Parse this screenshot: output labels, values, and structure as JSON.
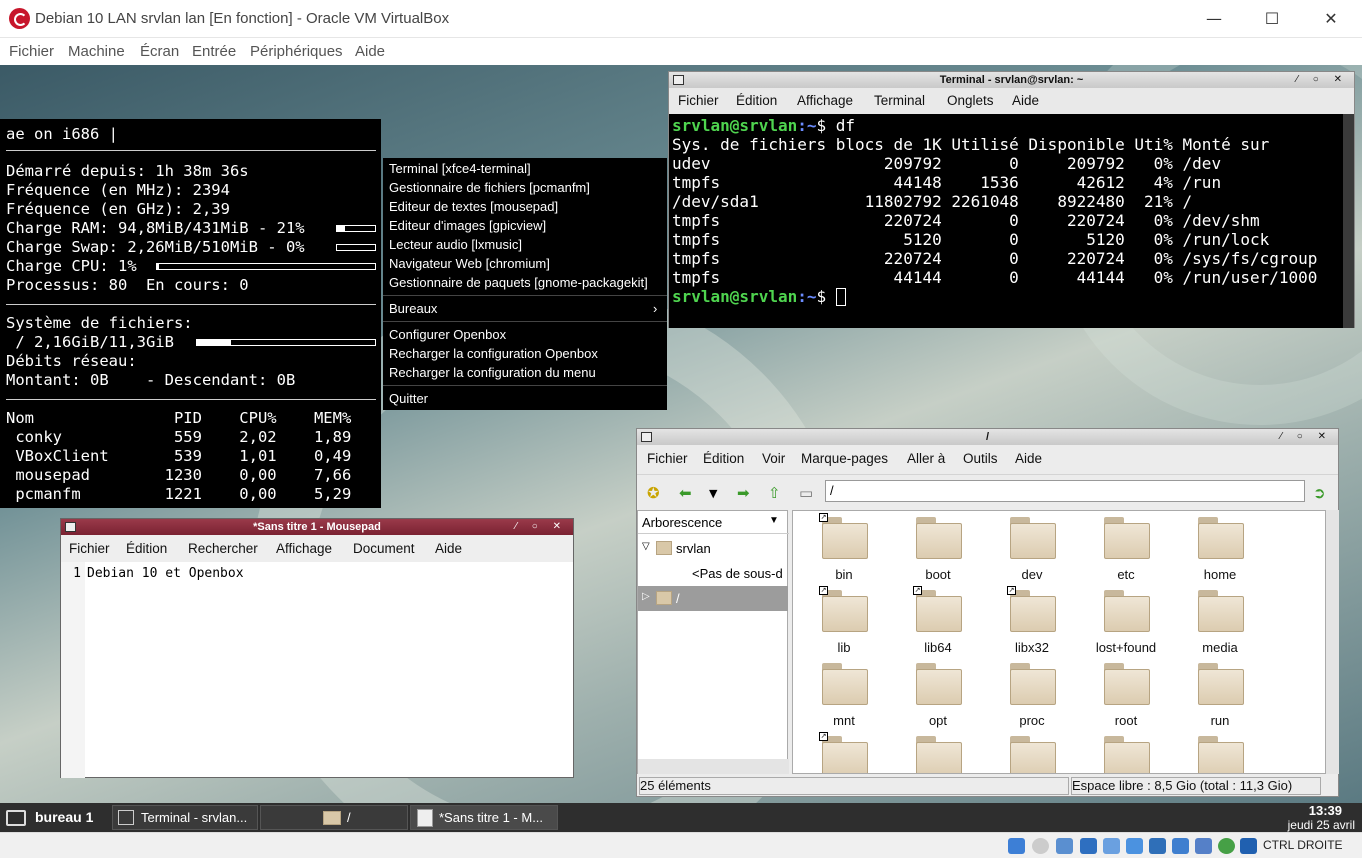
{
  "vbox": {
    "title": "Debian 10 LAN srvlan lan [En fonction] - Oracle VM VirtualBox",
    "menu": [
      "Fichier",
      "Machine",
      "Écran",
      "Entrée",
      "Périphériques",
      "Aide"
    ],
    "min": "—",
    "max": "☐",
    "close": "✕",
    "host_key": "CTRL DROITE"
  },
  "conky": {
    "header": "ae on i686 |",
    "lines": [
      "Démarré depuis: 1h 38m 36s",
      "Fréquence (en MHz): 2394",
      "Fréquence (en GHz): 2,39",
      "Charge RAM: 94,8MiB/431MiB - 21%",
      "Charge Swap: 2,26MiB/510MiB - 0%",
      "Charge CPU: 1%",
      "Processus: 80  En cours: 0",
      "",
      "Système de fichiers:",
      " / 2,16GiB/11,3GiB",
      "Débits réseau:",
      "Montant: 0B    - Descendant: 0B",
      "",
      "Nom               PID    CPU%    MEM%",
      " conky            559    2,02    1,89",
      " VBoxClient       539    1,01    0,49",
      " mousepad        1230    0,00    7,66",
      " pcmanfm         1221    0,00    5,29"
    ],
    "ram_pct": 0.21,
    "swap_pct": 0.0,
    "cpu_pct": 0.01,
    "fs_pct": 0.19
  },
  "ctxmenu": {
    "items1": [
      "Terminal [xfce4-terminal]",
      "Gestionnaire de fichiers [pcmanfm]",
      "Editeur de textes [mousepad]",
      "Editeur d'images [gpicview]",
      "Lecteur audio [lxmusic]",
      "Navigateur Web [chromium]",
      "Gestionnaire de paquets [gnome-packagekit]"
    ],
    "bureaux": "Bureaux",
    "arrow": "›",
    "items2": [
      "Configurer Openbox",
      "Recharger la configuration Openbox",
      "Recharger la configuration du menu"
    ],
    "quit": "Quitter"
  },
  "terminal": {
    "title": "Terminal - srvlan@srvlan: ~",
    "menu": [
      "Fichier",
      "Édition",
      "Affichage",
      "Terminal",
      "Onglets",
      "Aide"
    ],
    "prompt_user": "srvlan@srvlan",
    "prompt_path": ":~",
    "cmd": "$ df",
    "prompt2": "$ ",
    "output": [
      "Sys. de fichiers blocs de 1K Utilisé Disponible Uti% Monté sur",
      "udev                  209792       0     209792   0% /dev",
      "tmpfs                  44148    1536      42612   4% /run",
      "/dev/sda1           11802792 2261048    8922480  21% /",
      "tmpfs                 220724       0     220724   0% /dev/shm",
      "tmpfs                   5120       0       5120   0% /run/lock",
      "tmpfs                 220724       0     220724   0% /sys/fs/cgroup",
      "tmpfs                  44144       0      44144   0% /run/user/1000"
    ]
  },
  "mousepad": {
    "title": "*Sans titre 1 - Mousepad",
    "menu": [
      "Fichier",
      "Édition",
      "Rechercher",
      "Affichage",
      "Document",
      "Aide"
    ],
    "line_no": "1",
    "text": "Debian 10 et Openbox"
  },
  "filemanager": {
    "title": "/",
    "menu": [
      "Fichier",
      "Édition",
      "Voir",
      "Marque-pages",
      "Aller à",
      "Outils",
      "Aide"
    ],
    "path": "/",
    "side_header": "Arborescence",
    "tree": [
      "srvlan",
      "<Pas de sous-d",
      "/"
    ],
    "folders": [
      "bin",
      "boot",
      "dev",
      "etc",
      "home",
      "lib",
      "lib64",
      "libx32",
      "lost+found",
      "media",
      "mnt",
      "opt",
      "proc",
      "root",
      "run",
      "",
      "",
      "",
      "",
      ""
    ],
    "status_left": "25 éléments",
    "status_right": "Espace libre : 8,5 Gio (total : 11,3 Gio)"
  },
  "taskbar": {
    "desktop": "bureau 1",
    "tasks": [
      "Terminal - srvlan...",
      "/",
      "*Sans titre 1 - M..."
    ],
    "time": "13:39",
    "date": "jeudi 25 avril"
  }
}
